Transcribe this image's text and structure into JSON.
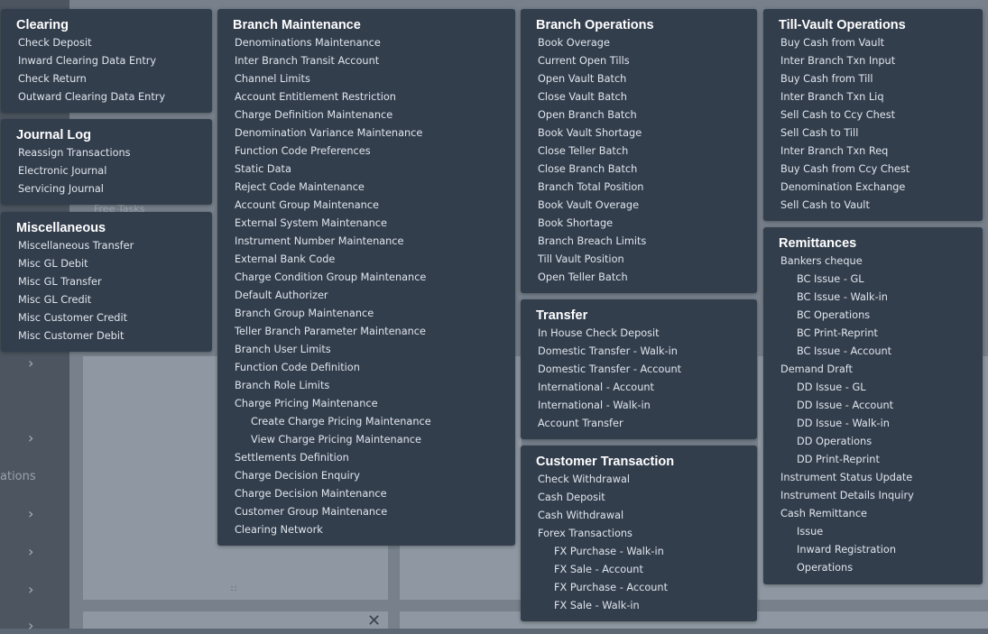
{
  "background": {
    "fragment_tasks": "Free Tasks",
    "fragment_operations": "ations"
  },
  "panels": {
    "clearing": {
      "title": "Clearing",
      "items": [
        "Check Deposit",
        "Inward Clearing Data Entry",
        "Check Return",
        "Outward Clearing Data Entry"
      ]
    },
    "journal_log": {
      "title": "Journal Log",
      "items": [
        "Reassign Transactions",
        "Electronic Journal",
        "Servicing Journal"
      ]
    },
    "miscellaneous": {
      "title": "Miscellaneous",
      "items": [
        "Miscellaneous Transfer",
        "Misc GL Debit",
        "Misc GL Transfer",
        "Misc GL Credit",
        "Misc Customer Credit",
        "Misc Customer Debit"
      ]
    },
    "branch_maintenance": {
      "title": "Branch Maintenance",
      "items": [
        "Denominations Maintenance",
        "Inter Branch Transit Account",
        "Channel Limits",
        "Account Entitlement Restriction",
        "Charge Definition Maintenance",
        "Denomination Variance Maintenance",
        "Function Code Preferences",
        "Static Data",
        "Reject Code Maintenance",
        "Account Group Maintenance",
        "External System Maintenance",
        "Instrument Number Maintenance",
        "External Bank Code",
        "Charge Condition Group Maintenance",
        "Default Authorizer",
        "Branch Group Maintenance",
        "Teller Branch Parameter Maintenance",
        "Branch User Limits",
        "Function Code Definition",
        "Branch Role Limits",
        "Charge Pricing Maintenance"
      ],
      "sub_items": [
        "Create Charge Pricing Maintenance",
        "View Charge Pricing Maintenance"
      ],
      "items_after": [
        "Settlements Definition",
        "Charge Decision Enquiry",
        "Charge Decision Maintenance",
        "Customer Group Maintenance",
        "Clearing Network"
      ]
    },
    "branch_operations": {
      "title": "Branch Operations",
      "items": [
        "Book Overage",
        "Current Open Tills",
        "Open Vault Batch",
        "Close Vault Batch",
        "Open Branch Batch",
        "Book Vault Shortage",
        "Close Teller Batch",
        "Close Branch Batch",
        "Branch Total Position",
        "Book Vault Overage",
        "Book Shortage",
        "Branch Breach Limits",
        "Till Vault Position",
        "Open Teller Batch"
      ]
    },
    "transfer": {
      "title": "Transfer",
      "items": [
        "In House Check Deposit",
        "Domestic Transfer - Walk-in",
        "Domestic Transfer - Account",
        "International - Account",
        "International - Walk-in",
        "Account Transfer"
      ]
    },
    "customer_transaction": {
      "title": "Customer Transaction",
      "items": [
        "Check Withdrawal",
        "Cash Deposit",
        "Cash Withdrawal",
        "Forex Transactions"
      ],
      "sub_items": [
        "FX Purchase - Walk-in",
        "FX Sale - Account",
        "FX Purchase - Account",
        "FX Sale - Walk-in"
      ]
    },
    "till_vault": {
      "title": "Till-Vault Operations",
      "items": [
        "Buy Cash from Vault",
        "Inter Branch Txn Input",
        "Buy Cash from Till",
        "Inter Branch Txn Liq",
        "Sell Cash to Ccy Chest",
        "Sell Cash to Till",
        "Inter Branch Txn Req",
        "Buy Cash from Ccy Chest",
        "Denomination Exchange",
        "Sell Cash to Vault"
      ]
    },
    "remittances": {
      "title": "Remittances",
      "bankers_cheque": "Bankers cheque",
      "bc_items": [
        "BC Issue - GL",
        "BC Issue - Walk-in",
        "BC Operations",
        "BC Print-Reprint",
        "BC Issue - Account"
      ],
      "demand_draft": "Demand Draft",
      "dd_items": [
        "DD Issue - GL",
        "DD Issue - Account",
        "DD Issue - Walk-in",
        "DD Operations",
        "DD Print-Reprint"
      ],
      "instrument_status_update": "Instrument Status Update",
      "instrument_details_inquiry": "Instrument Details Inquiry",
      "cash_remittance": "Cash Remittance",
      "cr_items": [
        "Issue",
        "Inward Registration",
        "Operations"
      ]
    }
  }
}
